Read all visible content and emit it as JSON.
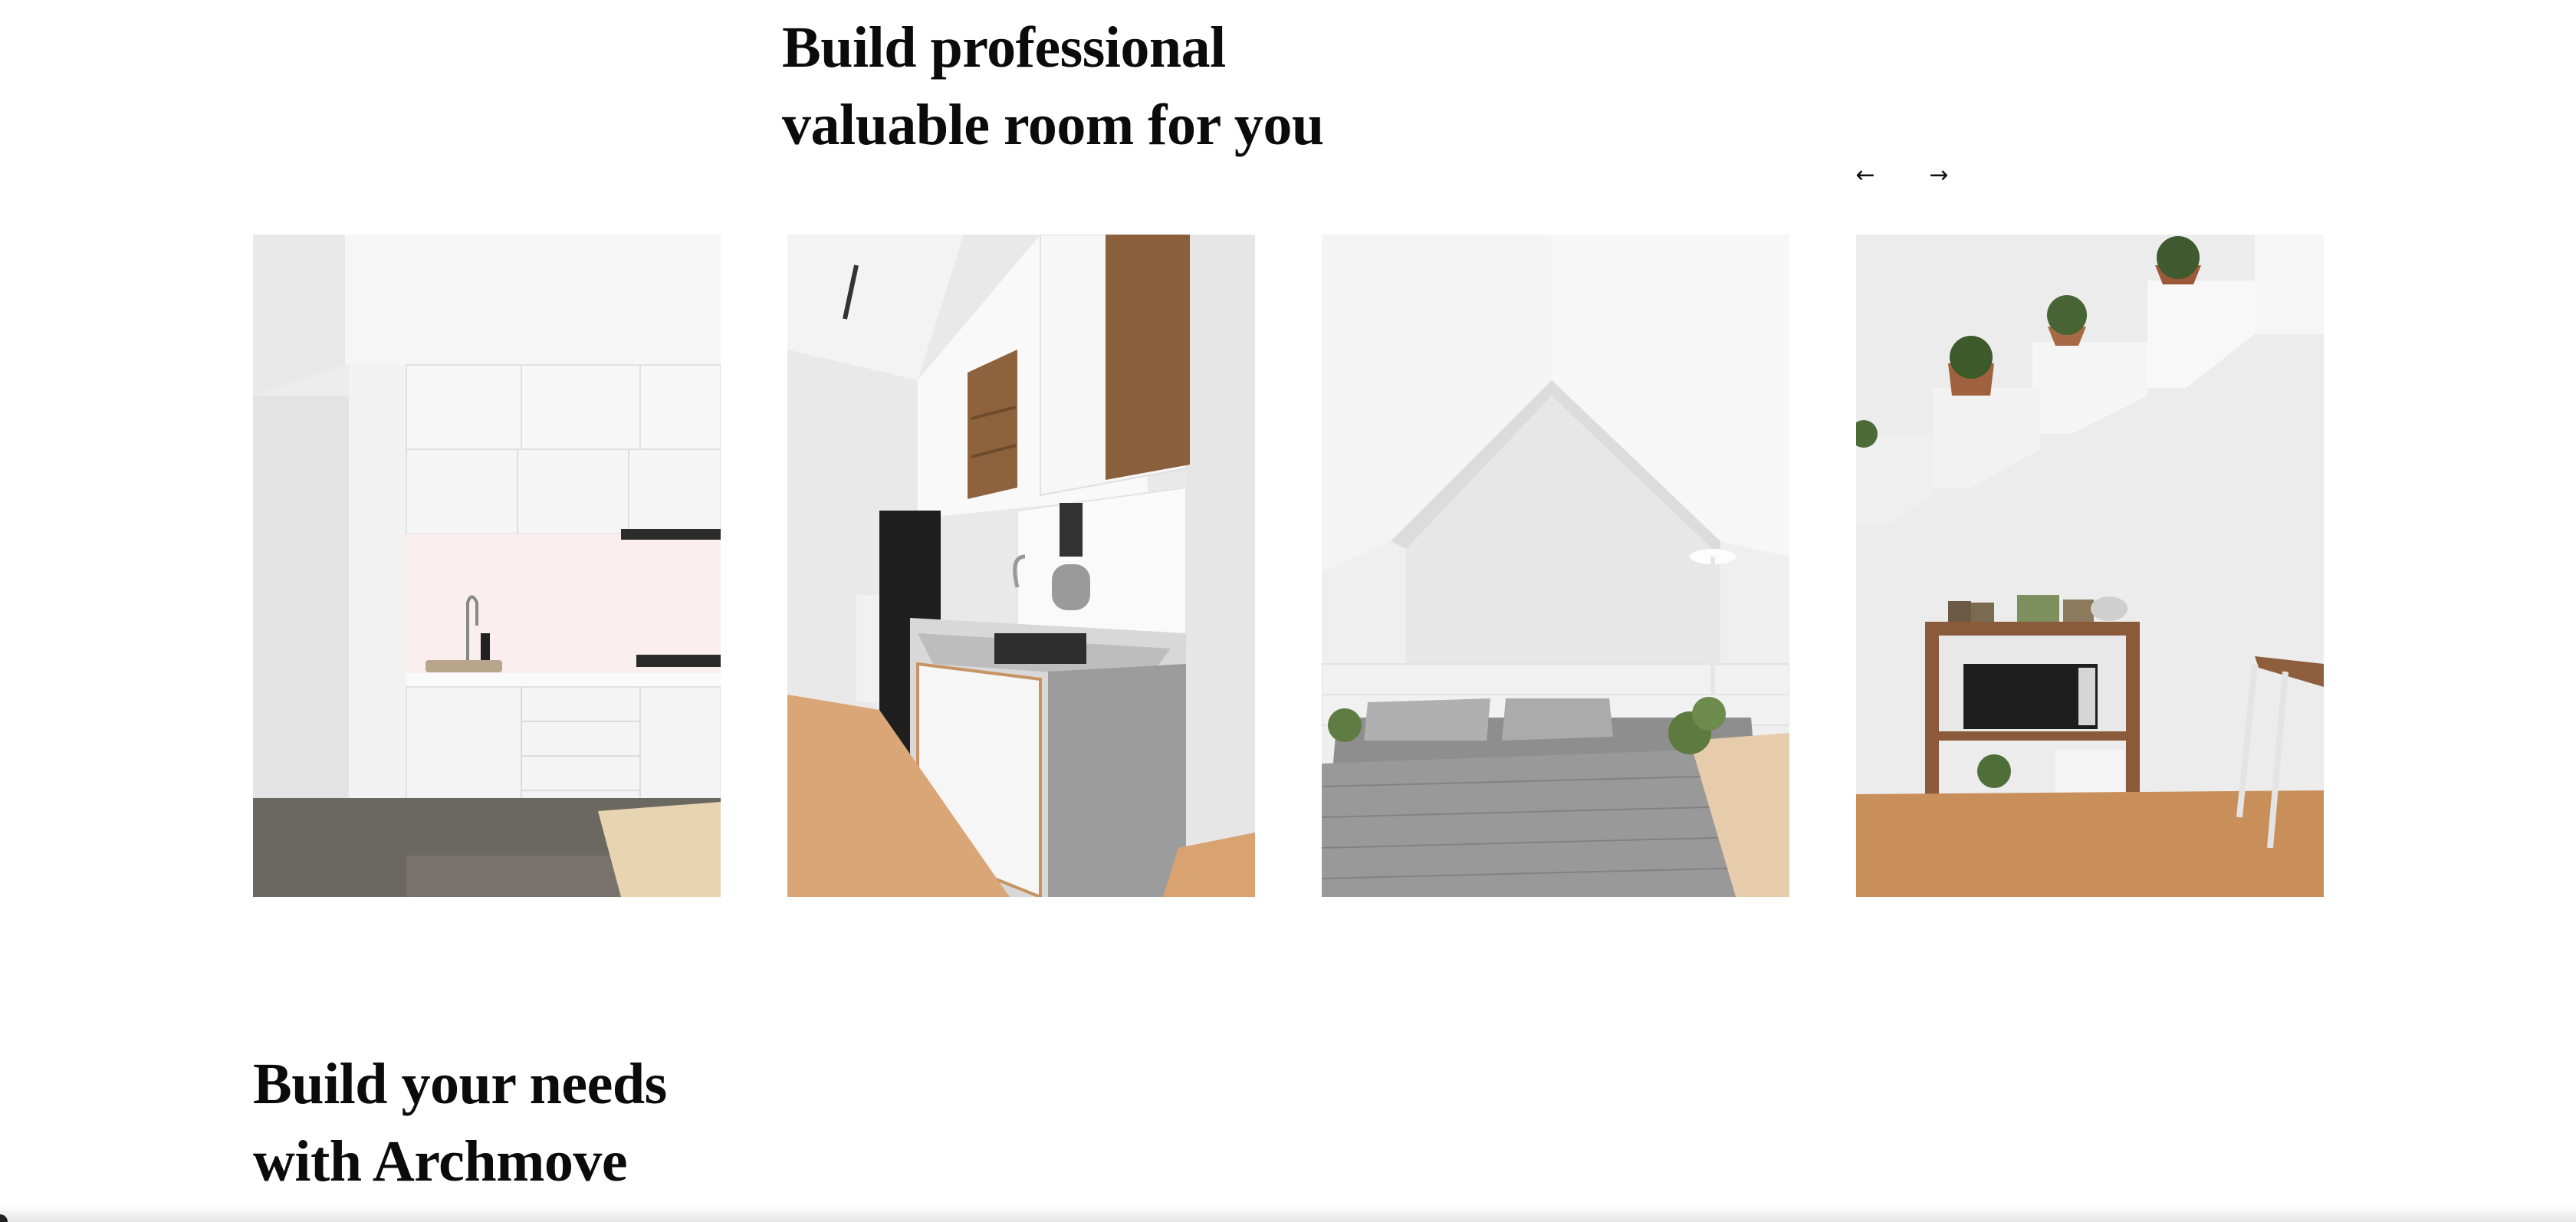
{
  "section_top": {
    "title": "Build professional\nvaluable room for you"
  },
  "carousel": {
    "prev_icon": "arrow-left-icon",
    "next_icon": "arrow-right-icon",
    "prev_glyph": "←",
    "next_glyph": "→",
    "images": [
      {
        "name": "white-kitchen"
      },
      {
        "name": "compact-kitchen-wood-shelves"
      },
      {
        "name": "white-bedroom-attic"
      },
      {
        "name": "stair-shelf-microwave-cart"
      }
    ]
  },
  "section_bottom": {
    "title": "Build your needs\nwith Archmove"
  }
}
